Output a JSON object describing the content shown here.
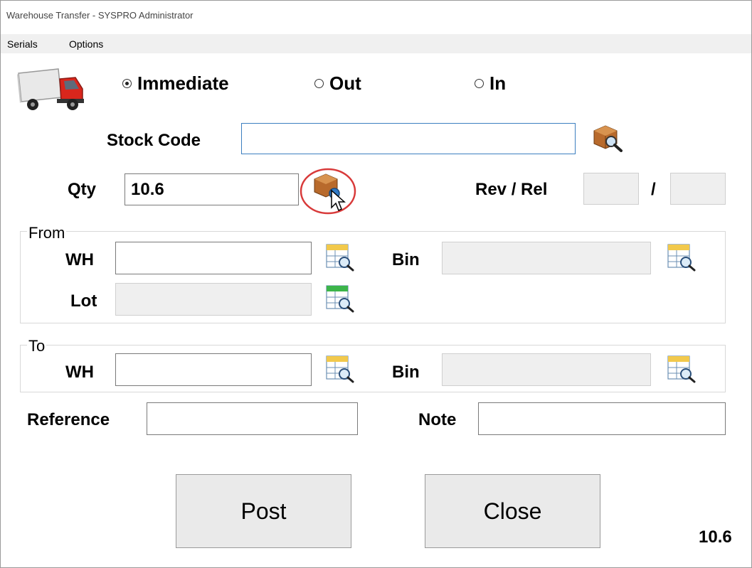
{
  "window": {
    "title": "Warehouse Transfer - SYSPRO Administrator"
  },
  "menu": {
    "items": [
      "Serials",
      "Options"
    ]
  },
  "mode": {
    "options": [
      "Immediate",
      "Out",
      "In"
    ],
    "selected": "Immediate"
  },
  "stock": {
    "label": "Stock Code",
    "value": ""
  },
  "qty": {
    "label": "Qty",
    "value": "10.6"
  },
  "revrel": {
    "label": "Rev / Rel",
    "separator": "/",
    "rev_value": "",
    "rel_value": ""
  },
  "from": {
    "title": "From",
    "wh_label": "WH",
    "wh_value": "",
    "bin_label": "Bin",
    "bin_value": "",
    "lot_label": "Lot",
    "lot_value": ""
  },
  "to": {
    "title": "To",
    "wh_label": "WH",
    "wh_value": "",
    "bin_label": "Bin",
    "bin_value": ""
  },
  "reference": {
    "label": "Reference",
    "value": ""
  },
  "note": {
    "label": "Note",
    "value": ""
  },
  "buttons": {
    "post": "Post",
    "close": "Close"
  },
  "status": {
    "value": "10.6"
  },
  "icons": {
    "truck": "truck-icon",
    "stock_browse": "box-search-icon",
    "qty_lookup": "box-lookup-icon",
    "table_search": "table-search-icon"
  },
  "colors": {
    "highlight_circle": "#d83a3a",
    "focus_border": "#3c7fc0"
  }
}
